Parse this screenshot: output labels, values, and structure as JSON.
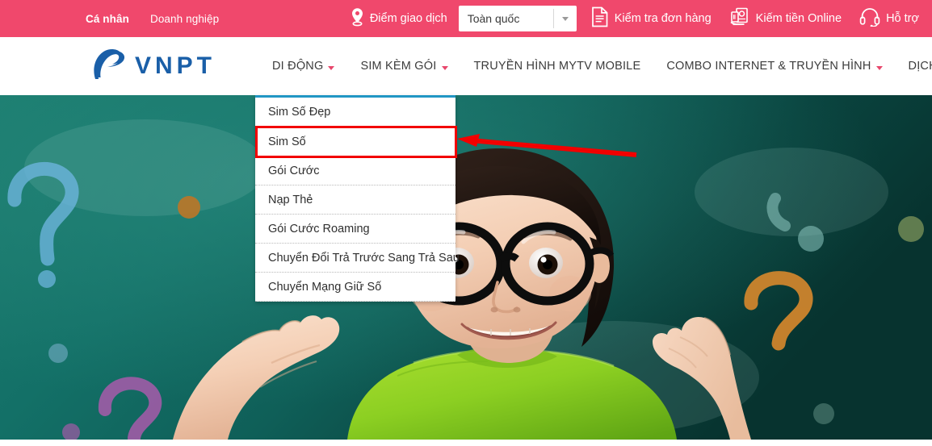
{
  "topbar": {
    "bg_color": "#f0486c",
    "links": [
      {
        "label": "Cá nhân",
        "bold": true
      },
      {
        "label": "Doanh nghiệp",
        "bold": false
      }
    ],
    "store_locator": {
      "icon": "location-pin-icon",
      "label": "Điểm giao dịch"
    },
    "region_select": {
      "value": "Toàn quốc",
      "placeholder": "Toàn quốc",
      "icon": "chevron-down-icon"
    },
    "order_check": {
      "icon": "document-icon",
      "label": "Kiểm tra đơn hàng"
    },
    "earn_online": {
      "icon": "money-hand-icon",
      "label": "Kiếm tiền Online"
    },
    "support": {
      "icon": "headset-icon",
      "label": "Hỗ trợ"
    }
  },
  "brand": {
    "logo_icon": "vnpt-swoosh-logo",
    "name": "VNPT",
    "logo_color": "#1a5fa8"
  },
  "nav": {
    "caret_color": "#e8476c",
    "items": [
      {
        "label": "DI ĐỘNG",
        "has_caret": true,
        "active": true
      },
      {
        "label": "SIM KÈM GÓI",
        "has_caret": true,
        "active": false
      },
      {
        "label": "TRUYỀN HÌNH MYTV MOBILE",
        "has_caret": false,
        "active": false
      },
      {
        "label": "COMBO INTERNET & TRUYỀN HÌNH",
        "has_caret": true,
        "active": false
      },
      {
        "label": "DỊCH VỤ SỐ",
        "has_caret": true,
        "active": false
      }
    ]
  },
  "dropdown": {
    "parent": "DI ĐỘNG",
    "top_border_color": "#2196c4",
    "items": [
      {
        "label": "Sim Số Đẹp",
        "highlighted": false
      },
      {
        "label": "Sim Số",
        "highlighted": true
      },
      {
        "label": "Gói Cước",
        "highlighted": false
      },
      {
        "label": "Nạp Thẻ",
        "highlighted": false
      },
      {
        "label": "Gói Cước Roaming",
        "highlighted": false
      },
      {
        "label": "Chuyển Đổi Trả Trước Sang Trả Sau",
        "highlighted": false
      },
      {
        "label": "Chuyển Mạng Giữ Số",
        "highlighted": false
      }
    ]
  },
  "annotations": {
    "highlight_box": {
      "target": "Sim Số",
      "color": "#f20000"
    },
    "arrow": {
      "direction": "left",
      "color": "#f20000",
      "points_to": "Sim Số"
    }
  },
  "hero": {
    "alt": "Child with large black glasses shrugging in front of a teal chalkboard with chalk question marks",
    "board_color": "#136b62",
    "shirt_color": "#8ccf2a"
  }
}
